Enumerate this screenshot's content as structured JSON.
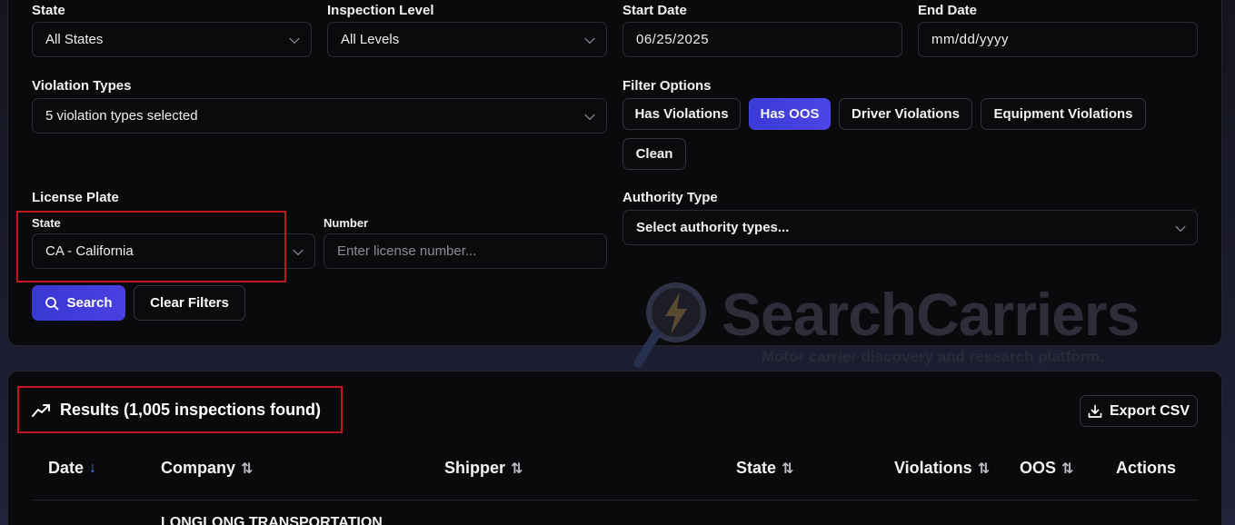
{
  "filters": {
    "state": {
      "label": "State",
      "value": "All States"
    },
    "inspection_level": {
      "label": "Inspection Level",
      "value": "All Levels"
    },
    "start_date": {
      "label": "Start Date",
      "value": "06/25/2025"
    },
    "end_date": {
      "label": "End Date",
      "placeholder": "mm/dd/yyyy"
    },
    "violation_types": {
      "label": "Violation Types",
      "value": "5 violation types selected"
    },
    "filter_options": {
      "label": "Filter Options",
      "chips": [
        "Has Violations",
        "Has OOS",
        "Driver Violations",
        "Equipment Violations",
        "Clean"
      ],
      "active": "Has OOS"
    },
    "license_plate": {
      "label": "License Plate",
      "state_label": "State",
      "state_value": "CA - California",
      "number_label": "Number",
      "number_placeholder": "Enter license number..."
    },
    "authority_type": {
      "label": "Authority Type",
      "placeholder": "Select authority types..."
    },
    "search_label": "Search",
    "clear_label": "Clear Filters"
  },
  "watermark": {
    "title": "SearchCarriers",
    "subtitle": "Motor carrier discovery and research platform."
  },
  "results": {
    "title": "Results (1,005 inspections found)",
    "export_label": "Export CSV",
    "columns": [
      "Date",
      "Company",
      "Shipper",
      "State",
      "Violations",
      "OOS",
      "Actions"
    ],
    "first_row_company": "LONGLONG TRANSPORTATION"
  },
  "colors": {
    "accent": "#4040dc",
    "highlight_box": "#c4161c",
    "sort_active": "#4f78ff"
  }
}
